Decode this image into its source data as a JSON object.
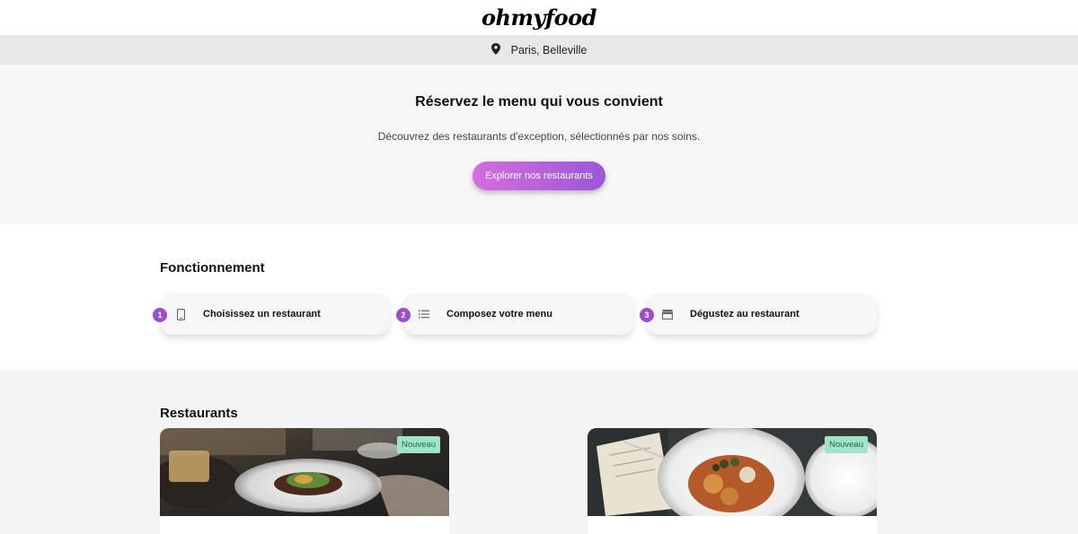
{
  "header": {
    "logo": "ohmyfood"
  },
  "location": {
    "icon": "location-pin-icon",
    "text": "Paris, Belleville"
  },
  "hero": {
    "title": "Réservez le menu qui vous convient",
    "subtitle": "Découvrez des restaurants d'exception, sélectionnés par nos soins.",
    "cta_label": "Explorer nos restaurants"
  },
  "how": {
    "title": "Fonctionnement",
    "steps": [
      {
        "number": "1",
        "icon": "mobile-phone-icon",
        "label": "Choisissez un restaurant"
      },
      {
        "number": "2",
        "icon": "list-icon",
        "label": "Composez votre menu"
      },
      {
        "number": "3",
        "icon": "store-icon",
        "label": "Dégustez au restaurant"
      }
    ]
  },
  "restaurants": {
    "title": "Restaurants",
    "cards": [
      {
        "badge": "Nouveau"
      },
      {
        "badge": "Nouveau"
      }
    ]
  },
  "colors": {
    "accent": "#9c4fcc",
    "cta_start": "#d76ce0",
    "cta_end": "#9a57d6",
    "badge_bg": "#9fe3c9"
  }
}
